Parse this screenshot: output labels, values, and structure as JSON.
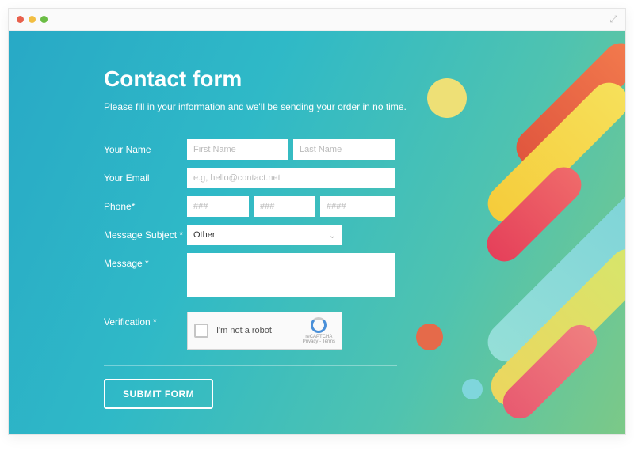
{
  "form": {
    "title": "Contact form",
    "subtitle": "Please fill in your information and we'll be sending your order in no time.",
    "labels": {
      "name": "Your Name",
      "email": "Your Email",
      "phone": "Phone*",
      "subject": "Message Subject *",
      "message": "Message *",
      "verification": "Verification *"
    },
    "placeholders": {
      "first_name": "First Name",
      "last_name": "Last Name",
      "email": "e.g, hello@contact.net",
      "phone1": "###",
      "phone2": "###",
      "phone3": "####"
    },
    "subject_value": "Other",
    "captcha_text": "I'm not a robot",
    "captcha_brand": "reCAPTCHA",
    "captcha_terms": "Privacy - Terms",
    "submit_label": "SUBMIT FORM"
  }
}
